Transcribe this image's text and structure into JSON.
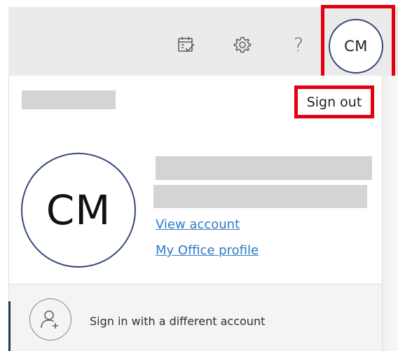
{
  "header": {
    "avatar_initials": "CM",
    "help_glyph": "?",
    "icons": [
      "calendar-check-icon",
      "settings-gear-icon",
      "help-icon"
    ]
  },
  "account_panel": {
    "sign_out_label": "Sign out",
    "avatar_initials": "CM",
    "view_account_label": "View account",
    "office_profile_label": "My Office profile",
    "switch_account_label": "Sign in with a different account"
  },
  "colors": {
    "highlight": "#e3000f",
    "avatar_border": "#37477a",
    "link": "#2f79c5",
    "header_bg": "#ebebeb"
  }
}
